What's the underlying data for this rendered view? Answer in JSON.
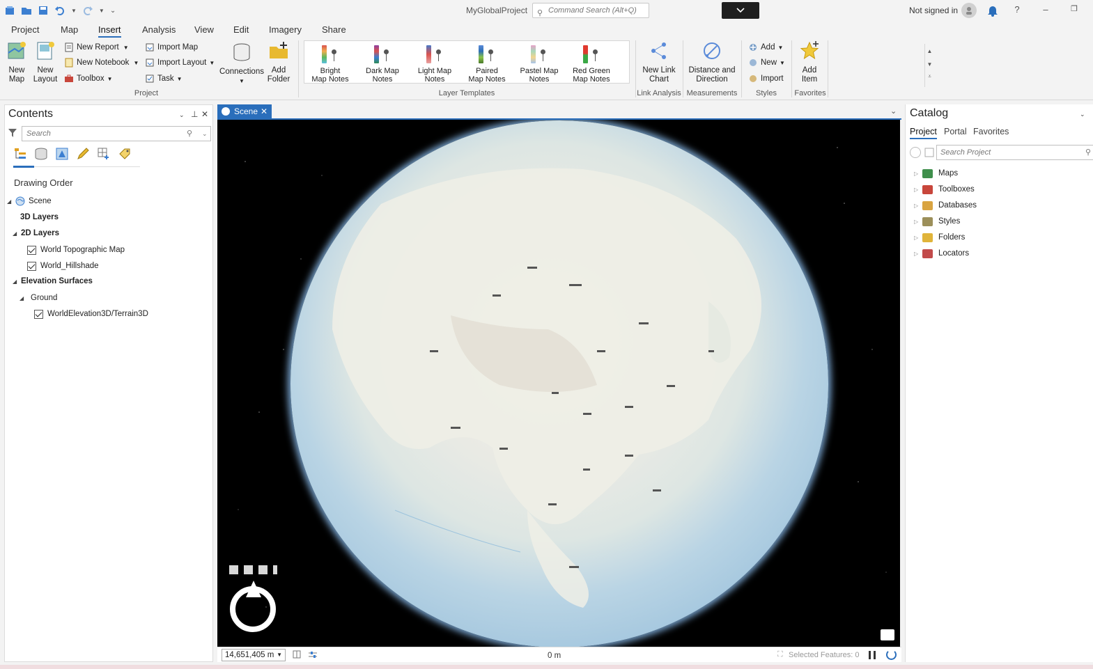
{
  "titlebar": {
    "app_title": "MyGlobalProject",
    "command_search_placeholder": "Command Search (Alt+Q)",
    "sign_in_status": "Not signed in",
    "help_label": "?"
  },
  "ribbon_tabs": [
    {
      "label": "Project",
      "active": false
    },
    {
      "label": "Map",
      "active": false
    },
    {
      "label": "Insert",
      "active": true
    },
    {
      "label": "Analysis",
      "active": false
    },
    {
      "label": "View",
      "active": false
    },
    {
      "label": "Edit",
      "active": false
    },
    {
      "label": "Imagery",
      "active": false
    },
    {
      "label": "Share",
      "active": false
    }
  ],
  "ribbon": {
    "project_group": {
      "label": "Project",
      "new_map": "New Map",
      "new_layout": "New Layout",
      "new_report": "New Report",
      "new_notebook": "New Notebook",
      "toolbox": "Toolbox",
      "import_map": "Import Map",
      "import_layout": "Import Layout",
      "task": "Task",
      "connections": "Connections",
      "add_folder": "Add Folder"
    },
    "layer_templates": {
      "label": "Layer Templates",
      "items": [
        {
          "line1": "Bright",
          "line2": "Map Notes",
          "color": "#d9534f"
        },
        {
          "line1": "Dark Map",
          "line2": "Notes",
          "color": "#8e3fa0"
        },
        {
          "line1": "Light Map",
          "line2": "Notes",
          "color": "#4a78c8"
        },
        {
          "line1": "Paired",
          "line2": "Map Notes",
          "color": "#5b8bd9"
        },
        {
          "line1": "Pastel Map",
          "line2": "Notes",
          "color": "#e7a3c8"
        },
        {
          "line1": "Red Green",
          "line2": "Map Notes",
          "color": "#e03a2f"
        }
      ]
    },
    "link_analysis": {
      "label": "Link Analysis",
      "new_link_chart": "New Link Chart"
    },
    "measurements": {
      "label": "Measurements",
      "distance_direction": "Distance and Direction"
    },
    "styles": {
      "label": "Styles",
      "add": "Add",
      "new": "New",
      "import": "Import"
    },
    "favorites": {
      "label": "Favorites",
      "add_item": "Add Item"
    }
  },
  "contents": {
    "title": "Contents",
    "search_placeholder": "Search",
    "drawing_order": "Drawing Order",
    "tree": {
      "scene": "Scene",
      "layers_3d": "3D Layers",
      "layers_2d": "2D Layers",
      "world_topo": "World Topographic Map",
      "world_hillshade": "World_Hillshade",
      "elevation_surfaces": "Elevation Surfaces",
      "ground": "Ground",
      "terrain": "WorldElevation3D/Terrain3D"
    }
  },
  "view": {
    "tab_label": "Scene",
    "scale": "14,651,405 m",
    "elevation": "0 m",
    "selected_features": "Selected Features: 0"
  },
  "catalog": {
    "title": "Catalog",
    "tabs": [
      {
        "label": "Project",
        "active": true
      },
      {
        "label": "Portal",
        "active": false
      },
      {
        "label": "Favorites",
        "active": false
      }
    ],
    "search_placeholder": "Search Project",
    "items": [
      {
        "label": "Maps",
        "color": "#3f8f4c"
      },
      {
        "label": "Toolboxes",
        "color": "#c8463b"
      },
      {
        "label": "Databases",
        "color": "#d9a441"
      },
      {
        "label": "Styles",
        "color": "#9c8f5a"
      },
      {
        "label": "Folders",
        "color": "#e0b43a"
      },
      {
        "label": "Locators",
        "color": "#c24b4b"
      }
    ]
  }
}
